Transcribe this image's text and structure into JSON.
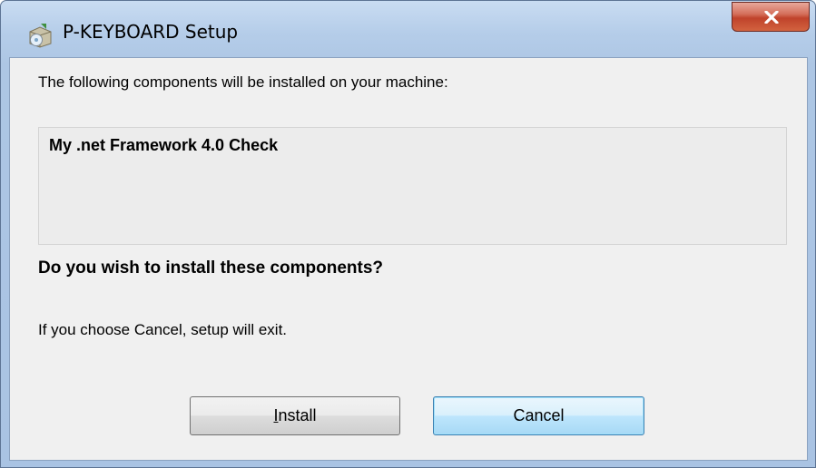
{
  "window": {
    "title": "P-KEYBOARD Setup",
    "app_icon": "setup-installer-icon",
    "close_icon": "close-x-icon"
  },
  "dialog": {
    "intro_text": "The following components will be installed on your machine:",
    "components": [
      "My .net Framework 4.0 Check"
    ],
    "question": "Do you wish to install these components?",
    "cancel_note": "If you choose Cancel, setup will exit."
  },
  "buttons": {
    "install": {
      "mnemonic": "I",
      "rest": "nstall"
    },
    "cancel": "Cancel"
  },
  "colors": {
    "close_button": "#c0432b",
    "default_button_border": "#3c7fb1",
    "client_background": "#f0f0f0"
  }
}
